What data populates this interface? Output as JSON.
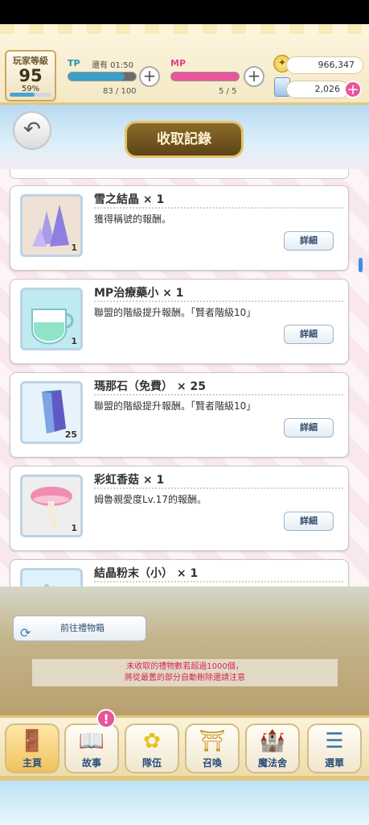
{
  "header": {
    "player_level_label": "玩家等級",
    "player_level": "95",
    "player_exp_percent": "59%",
    "player_exp_fraction": 0.59,
    "tp": {
      "name": "TP",
      "status": "還有 01:50",
      "value": "83 / 100",
      "fill": 0.83,
      "color": "#3b9fc7"
    },
    "mp": {
      "name": "MP",
      "value": "5 / 5",
      "fill": 1.0,
      "color": "#e8559a"
    },
    "mana": "966,347",
    "jewels": "2,026"
  },
  "page_title": "收取記錄",
  "items": [
    {
      "name": "雪之結晶 × 1",
      "desc": "獲得稱號的報酬。",
      "qty": "1",
      "icon": "crystal-icon",
      "thumb_bg": "#efe2d4"
    },
    {
      "name": "MP治療藥小 × 1",
      "desc": "聯盟的階級提升報酬。「賢者階級10」",
      "qty": "1",
      "icon": "potion-icon",
      "thumb_bg": "#bfeaf0"
    },
    {
      "name": "瑪那石（免費） × 25",
      "desc": "聯盟的階級提升報酬。「賢者階級10」",
      "qty": "25",
      "icon": "manastone-icon",
      "thumb_bg": "#e7f3fb"
    },
    {
      "name": "彩虹香菇 × 1",
      "desc": "姆魯親愛度Lv.17的報酬。",
      "qty": "1",
      "icon": "mushroom-icon",
      "thumb_bg": "#eeeeee"
    },
    {
      "name": "結晶粉末（小） × 1",
      "desc": "",
      "qty": "",
      "icon": "powder-icon",
      "thumb_bg": "#dff1fb"
    }
  ],
  "detail_label": "詳細",
  "giftbox_button": "前往禮物箱",
  "notice": [
    "未收取的禮物數若超過1000個，",
    "將從最舊的部分自動刪除還請注意"
  ],
  "nav": [
    {
      "label": "主頁",
      "icon": "door-icon",
      "glyph": "🚪",
      "active": true
    },
    {
      "label": "故事",
      "icon": "book-icon",
      "glyph": "📖",
      "active": false
    },
    {
      "label": "隊伍",
      "icon": "lily-icon",
      "glyph": "✿",
      "active": false
    },
    {
      "label": "召喚",
      "icon": "gate-icon",
      "glyph": "⛩",
      "active": false
    },
    {
      "label": "魔法舍",
      "icon": "castle-icon",
      "glyph": "🏰",
      "active": false
    },
    {
      "label": "選單",
      "icon": "menu-icon",
      "glyph": "☰",
      "active": false
    }
  ],
  "story_badge": "!"
}
